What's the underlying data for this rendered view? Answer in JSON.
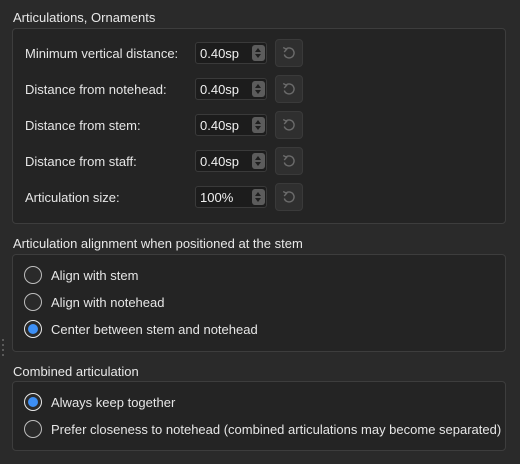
{
  "articulations": {
    "title": "Articulations, Ornaments",
    "rows": [
      {
        "label": "Minimum vertical distance:",
        "value": "0.40sp"
      },
      {
        "label": "Distance from notehead:",
        "value": "0.40sp"
      },
      {
        "label": "Distance from stem:",
        "value": "0.40sp"
      },
      {
        "label": "Distance from staff:",
        "value": "0.40sp"
      },
      {
        "label": "Articulation size:",
        "value": "100%"
      }
    ]
  },
  "alignment": {
    "title": "Articulation alignment when positioned at the stem",
    "options": [
      {
        "label": "Align with stem",
        "selected": false
      },
      {
        "label": "Align with notehead",
        "selected": false
      },
      {
        "label": "Center between stem and notehead",
        "selected": true
      }
    ]
  },
  "combined": {
    "title": "Combined articulation",
    "options": [
      {
        "label": "Always keep together",
        "selected": true
      },
      {
        "label": "Prefer closeness to notehead (combined articulations may become separated)",
        "selected": false
      }
    ]
  },
  "colors": {
    "accent": "#3d8ff5",
    "background": "#2a2a2a",
    "panel": "#242424"
  },
  "icons": {
    "reset": "reset-arrow-icon",
    "spin": "spin-arrows-icon"
  }
}
